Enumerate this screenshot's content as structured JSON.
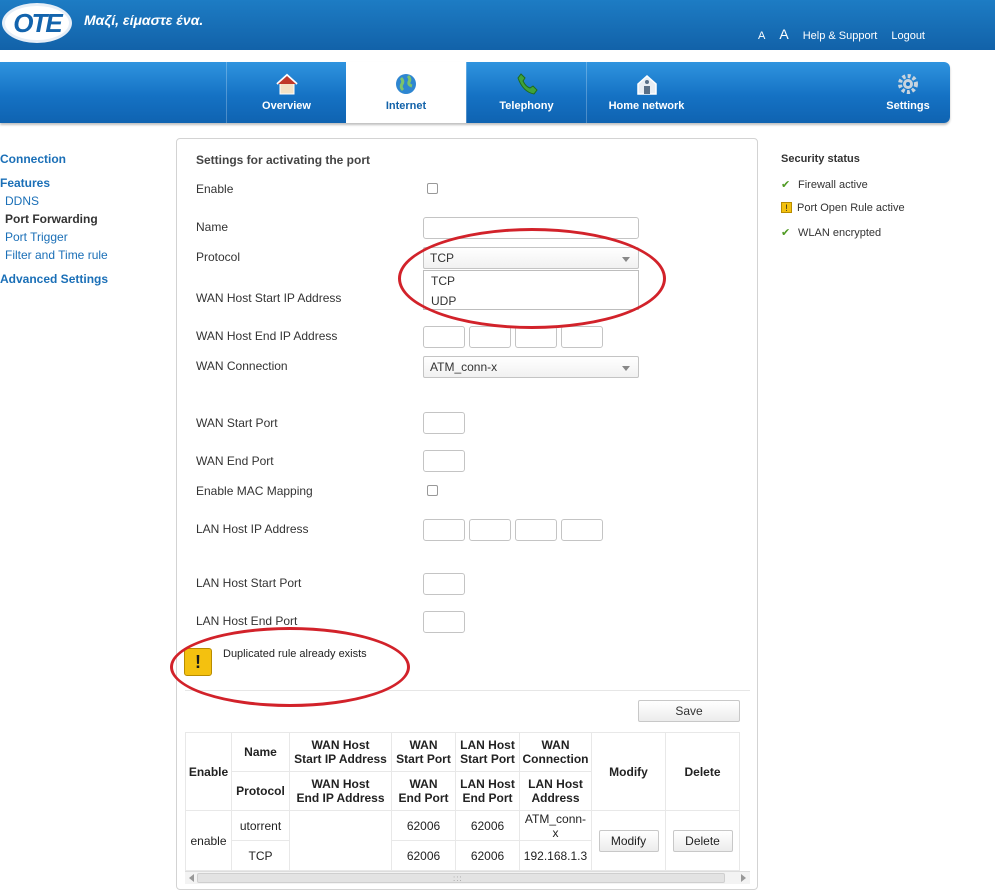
{
  "header": {
    "logo_text": "OTE",
    "slogan": "Μαζί, είμαστε ένα.",
    "font_small": "A",
    "font_large": "A",
    "help_label": "Help & Support",
    "logout_label": "Logout"
  },
  "nav": {
    "tabs": [
      {
        "label": "Overview",
        "icon": "home-icon"
      },
      {
        "label": "Internet",
        "icon": "globe-icon",
        "active": true
      },
      {
        "label": "Telephony",
        "icon": "phone-icon"
      },
      {
        "label": "Home network",
        "icon": "home-network-icon"
      },
      {
        "label": "Settings",
        "icon": "gear-icon"
      }
    ]
  },
  "sidebar": {
    "connection": "Connection",
    "features": "Features",
    "ddns": "DDNS",
    "port_forwarding": "Port Forwarding",
    "port_trigger": "Port Trigger",
    "filter_time": "Filter and Time rule",
    "advanced": "Advanced Settings"
  },
  "form": {
    "title": "Settings for activating the port",
    "enable": "Enable",
    "name": "Name",
    "protocol": "Protocol",
    "protocol_value": "TCP",
    "protocol_options": [
      "TCP",
      "UDP"
    ],
    "wan_start_ip": "WAN Host Start IP Address",
    "wan_end_ip": "WAN Host End IP Address",
    "wan_connection": "WAN Connection",
    "wan_connection_value": "ATM_conn-x",
    "wan_start_port": "WAN Start Port",
    "wan_end_port": "WAN End Port",
    "enable_mac": "Enable MAC Mapping",
    "lan_ip": "LAN Host IP Address",
    "lan_start_port": "LAN Host Start Port",
    "lan_end_port": "LAN Host End Port",
    "ip_separator": ".",
    "warning": "Duplicated rule already exists",
    "warning_symbol": "!",
    "save": "Save"
  },
  "table": {
    "headers": {
      "enable": "Enable",
      "name": "Name",
      "protocol": "Protocol",
      "wan_start_ip_1": "WAN Host",
      "wan_start_ip_2": "Start IP Address",
      "wan_end_ip_1": "WAN Host",
      "wan_end_ip_2": "End IP Address",
      "wan_start_port_1": "WAN",
      "wan_start_port_2": "Start Port",
      "wan_end_port_1": "WAN",
      "wan_end_port_2": "End Port",
      "lan_start_port_1": "LAN Host",
      "lan_start_port_2": "Start Port",
      "lan_end_port_1": "LAN Host",
      "lan_end_port_2": "End Port",
      "wan_conn_1": "WAN",
      "wan_conn_2": "Connection",
      "lan_addr_1": "LAN Host",
      "lan_addr_2": "Address",
      "modify": "Modify",
      "delete": "Delete"
    },
    "row": {
      "enable": "enable",
      "name": "utorrent",
      "protocol": "TCP",
      "wan_start_port": "62006",
      "wan_end_port": "62006",
      "lan_start_port": "62006",
      "lan_end_port": "62006",
      "wan_conn_1": "ATM_conn-",
      "wan_conn_2": "x",
      "lan_addr": "192.168.1.3",
      "modify": "Modify",
      "delete": "Delete"
    },
    "scroll_grip": ":::"
  },
  "status": {
    "title": "Security status",
    "items": [
      {
        "label": "Firewall active",
        "state": "ok"
      },
      {
        "label": "Port Open Rule active",
        "state": "warning"
      },
      {
        "label": "WLAN encrypted",
        "state": "ok"
      }
    ],
    "check_glyph": "✔",
    "warn_glyph": "!"
  },
  "colors": {
    "brand_blue": "#1262a9",
    "link_blue": "#1a6fb7",
    "annotation_red": "#d2222a",
    "warning_yellow": "#f4c10f",
    "ok_green": "#4f9a22"
  }
}
